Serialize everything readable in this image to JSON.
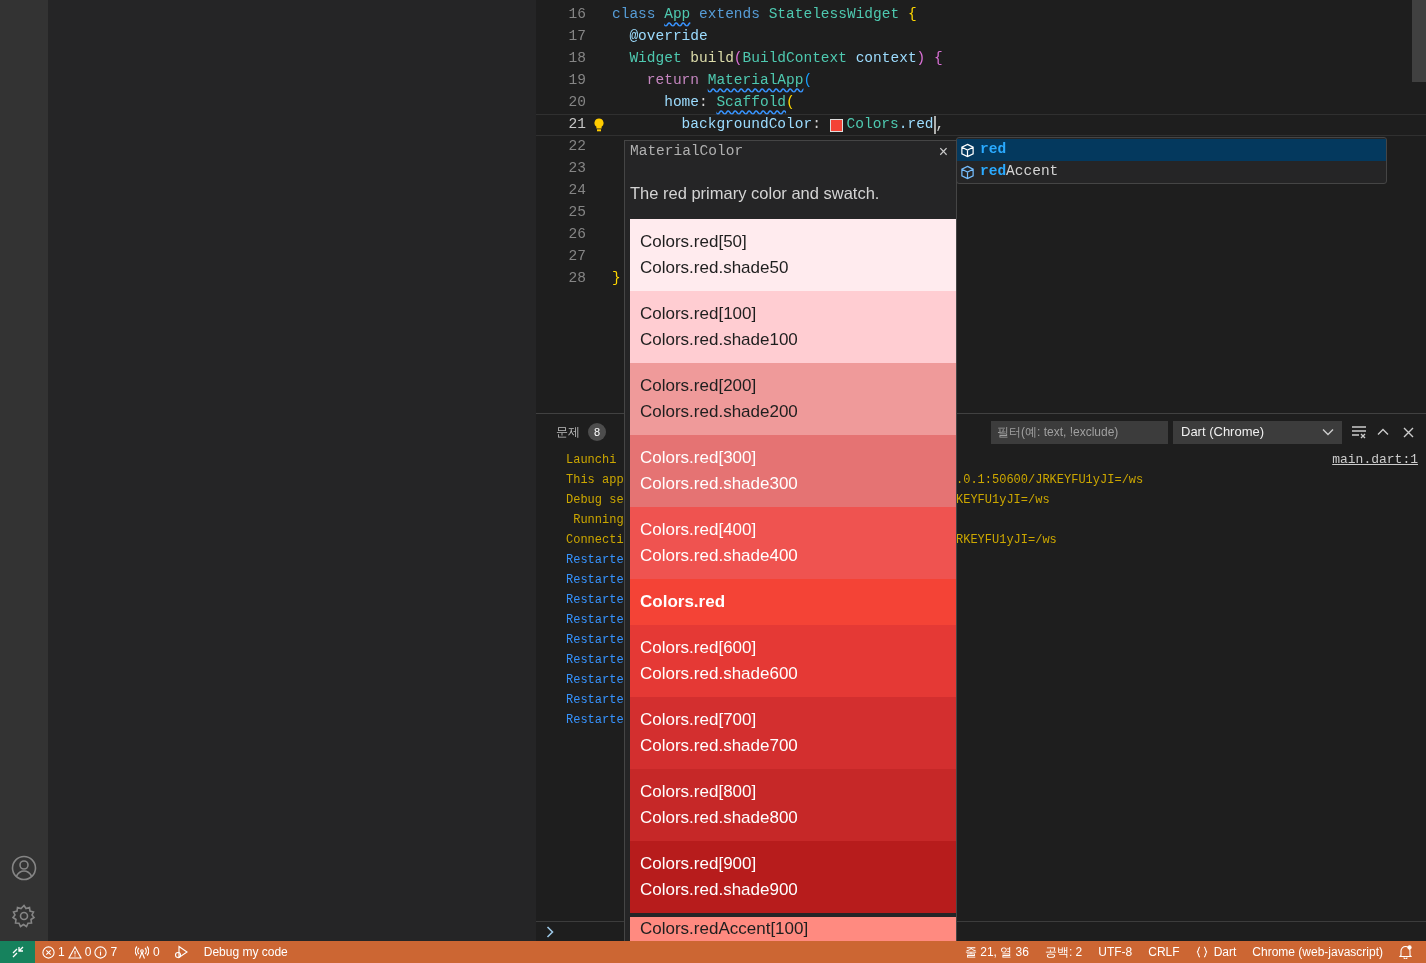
{
  "editor": {
    "lines": [
      {
        "number": "16",
        "current": false,
        "lightbulb": false,
        "tokens": [
          {
            "text": "class ",
            "kind": "keyword"
          },
          {
            "text": "App",
            "kind": "type",
            "squiggle": true
          },
          {
            "text": " extends",
            "kind": "keyword"
          },
          {
            "text": " StatelessWidget ",
            "kind": "type"
          },
          {
            "text": "{",
            "kind": "bracket1"
          }
        ]
      },
      {
        "number": "17",
        "current": false,
        "lightbulb": false,
        "tokens": [
          {
            "text": "  @override",
            "kind": "annotation"
          }
        ]
      },
      {
        "number": "18",
        "current": false,
        "lightbulb": false,
        "tokens": [
          {
            "text": "  Widget ",
            "kind": "type"
          },
          {
            "text": "build",
            "kind": "function"
          },
          {
            "text": "(",
            "kind": "bracket2"
          },
          {
            "text": "BuildContext ",
            "kind": "type"
          },
          {
            "text": "context",
            "kind": "param"
          },
          {
            "text": ")",
            "kind": "bracket2"
          },
          {
            "text": " {",
            "kind": "bracket2"
          }
        ]
      },
      {
        "number": "19",
        "current": false,
        "lightbulb": false,
        "tokens": [
          {
            "text": "    return ",
            "kind": "control"
          },
          {
            "text": "MaterialApp",
            "kind": "type",
            "squiggle": true
          },
          {
            "text": "(",
            "kind": "bracket3"
          }
        ]
      },
      {
        "number": "20",
        "current": false,
        "lightbulb": false,
        "tokens": [
          {
            "text": "      home",
            "kind": "param"
          },
          {
            "text": ": ",
            "kind": "plain"
          },
          {
            "text": "Scaffold",
            "kind": "type",
            "squiggle": true
          },
          {
            "text": "(",
            "kind": "bracket1"
          }
        ]
      },
      {
        "number": "21",
        "current": true,
        "lightbulb": true,
        "tokens": [
          {
            "text": "        backgroundColor",
            "kind": "param"
          },
          {
            "text": ": ",
            "kind": "plain"
          },
          {
            "kind": "color_chip",
            "color": "#f44336"
          },
          {
            "text": "Colors",
            "kind": "type"
          },
          {
            "text": ".red",
            "kind": "param"
          },
          {
            "kind": "cursor"
          },
          {
            "text": ",",
            "kind": "plain"
          }
        ]
      },
      {
        "number": "22",
        "current": false,
        "lightbulb": false
      },
      {
        "number": "23",
        "current": false,
        "lightbulb": false
      },
      {
        "number": "24",
        "current": false,
        "lightbulb": false
      },
      {
        "number": "25",
        "current": false,
        "lightbulb": false
      },
      {
        "number": "26",
        "current": false,
        "lightbulb": false
      },
      {
        "number": "27",
        "current": false,
        "lightbulb": false
      },
      {
        "number": "28",
        "current": false,
        "lightbulb": false,
        "tokens": [
          {
            "text": "}",
            "kind": "bracket1"
          }
        ]
      }
    ]
  },
  "suggest": {
    "items": [
      {
        "match": "red",
        "selected": true
      },
      {
        "match": "red",
        "rest": "Accent",
        "selected": false
      }
    ]
  },
  "hover": {
    "type_name": "MaterialColor",
    "close": "×",
    "description": "The red primary color and swatch.",
    "swatches": [
      {
        "kind": "shade",
        "lines": [
          "Colors.red[50]",
          "Colors.red.shade50"
        ],
        "color": "#ffebee",
        "dark_text": true
      },
      {
        "kind": "shade",
        "lines": [
          "Colors.red[100]",
          "Colors.red.shade100"
        ],
        "color": "#ffcdd2",
        "dark_text": true
      },
      {
        "kind": "shade",
        "lines": [
          "Colors.red[200]",
          "Colors.red.shade200"
        ],
        "color": "#ef9a9a",
        "dark_text": true
      },
      {
        "kind": "shade",
        "lines": [
          "Colors.red[300]",
          "Colors.red.shade300"
        ],
        "color": "#e57373",
        "dark_text": false
      },
      {
        "kind": "shade",
        "lines": [
          "Colors.red[400]",
          "Colors.red.shade400"
        ],
        "color": "#ef5350",
        "dark_text": false
      },
      {
        "kind": "primary",
        "lines": [
          "Colors.red"
        ],
        "color": "#f44336",
        "dark_text": false
      },
      {
        "kind": "shade",
        "lines": [
          "Colors.red[600]",
          "Colors.red.shade600"
        ],
        "color": "#e53935",
        "dark_text": false
      },
      {
        "kind": "shade",
        "lines": [
          "Colors.red[700]",
          "Colors.red.shade700"
        ],
        "color": "#d32f2f",
        "dark_text": false
      },
      {
        "kind": "shade",
        "lines": [
          "Colors.red[800]",
          "Colors.red.shade800"
        ],
        "color": "#c62828",
        "dark_text": false
      },
      {
        "kind": "shade",
        "lines": [
          "Colors.red[900]",
          "Colors.red.shade900"
        ],
        "color": "#b71c1c",
        "dark_text": false
      },
      {
        "kind": "accent",
        "lines": [
          "Colors.redAccent[100]"
        ],
        "color": "#ff8a80",
        "dark_text": true
      }
    ]
  },
  "panel": {
    "problems_tab": {
      "label": "문제",
      "badge": "8"
    },
    "filter": {
      "placeholder": "필터(예: text, !exclude)"
    },
    "target": "Dart (Chrome)",
    "link": "main.dart:1",
    "output": [
      {
        "left": "Launchi",
        "color": "#cca700"
      },
      {
        "left": "This app",
        "right": ".0.1:50600/JRKEYFU1yJI=/ws",
        "color": "#cca700"
      },
      {
        "left": "Debug se",
        "right": "KEYFU1yJI=/ws",
        "color": "#cca700"
      },
      {
        "left": " Running",
        "color": "#cca700"
      },
      {
        "left": "Connecti",
        "right": "RKEYFU1yJI=/ws",
        "color": "#cca700"
      },
      {
        "left": "Restarte",
        "color": "#3794ff"
      },
      {
        "left": "Restarte",
        "color": "#3794ff"
      },
      {
        "left": "Restarte",
        "color": "#3794ff"
      },
      {
        "left": "Restarte",
        "color": "#3794ff"
      },
      {
        "left": "Restarte",
        "color": "#3794ff"
      },
      {
        "left": "Restarte",
        "color": "#3794ff"
      },
      {
        "left": "Restarte",
        "color": "#3794ff"
      },
      {
        "left": "Restarte",
        "color": "#3794ff"
      },
      {
        "left": "Restarte",
        "color": "#3794ff"
      }
    ]
  },
  "status_bar": {
    "errors": "1",
    "warnings": "0",
    "infos": "7",
    "ports": "0",
    "debug": "Debug my code",
    "position": "줄 21, 열 36",
    "indent": "공백: 2",
    "encoding": "UTF-8",
    "eol": "CRLF",
    "language": "Dart",
    "target": "Chrome (web-javascript)"
  }
}
